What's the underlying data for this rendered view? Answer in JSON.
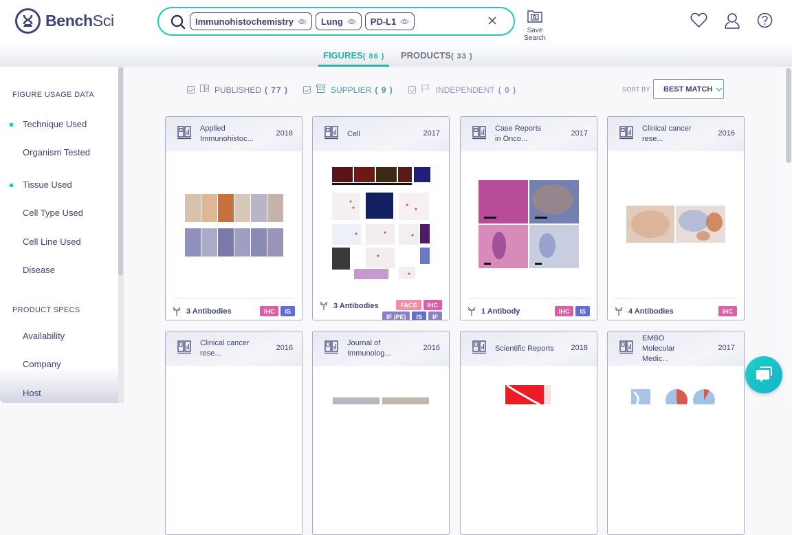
{
  "app": {
    "brand_bold": "Bench",
    "brand_light": "Sci"
  },
  "search": {
    "chips": [
      {
        "label": "Immunohistochemistry"
      },
      {
        "label": "Lung"
      },
      {
        "label": "PD-L1"
      }
    ],
    "save_label": "Save Search"
  },
  "header_icons": [
    "heart-icon",
    "user-icon",
    "help-icon"
  ],
  "tabs": [
    {
      "label": "FIGURES",
      "count": "( 86 )",
      "active": true
    },
    {
      "label": "PRODUCTS",
      "count": "( 33 )",
      "active": false
    }
  ],
  "sidebar": {
    "sections": [
      {
        "title": "FIGURE USAGE DATA",
        "items": [
          {
            "label": "Technique Used",
            "active": true
          },
          {
            "label": "Organism Tested",
            "active": false
          },
          {
            "label": "Tissue Used",
            "active": true
          },
          {
            "label": "Cell Type Used",
            "active": false
          },
          {
            "label": "Cell Line Used",
            "active": false
          },
          {
            "label": "Disease",
            "active": false
          }
        ]
      },
      {
        "title": "PRODUCT SPECS",
        "items": [
          {
            "label": "Availability"
          },
          {
            "label": "Company"
          },
          {
            "label": "Host"
          }
        ]
      }
    ]
  },
  "filters": [
    {
      "label": "PUBLISHED",
      "count": "( 77 )",
      "checked": true,
      "color": "#6f7aa8"
    },
    {
      "label": "SUPPLIER",
      "count": "( 9 )",
      "checked": true,
      "color": "#4e9aa6"
    },
    {
      "label": "INDEPENDENT",
      "count": "( 0 )",
      "checked": true,
      "color": "#9b8fdc"
    }
  ],
  "sort": {
    "label": "SORT BY",
    "value": "BEST MATCH"
  },
  "cards": [
    {
      "title": "Applied Immunohistoc...",
      "year": "2018",
      "antibodies": "3 Antibodies",
      "tags": [
        "IHC",
        "IS"
      ]
    },
    {
      "title": "Cell",
      "year": "2017",
      "antibodies": "3 Antibodies",
      "tags": [
        "FACS",
        "IHC",
        "IF (PE)",
        "IS",
        "IF"
      ]
    },
    {
      "title": "Case Reports in Onco...",
      "year": "2017",
      "antibodies": "1 Antibody",
      "tags": [
        "IHC",
        "IS"
      ]
    },
    {
      "title": "Clinical cancer rese...",
      "year": "2016",
      "antibodies": "4 Antibodies",
      "tags": [
        "IHC"
      ]
    },
    {
      "title": "Clinical cancer rese...",
      "year": "2016"
    },
    {
      "title": "Journal of Immunolog...",
      "year": "2016"
    },
    {
      "title": "Scientific Reports",
      "year": "2018"
    },
    {
      "title": "EMBO Molecular Medic...",
      "year": "2017"
    }
  ],
  "colors": {
    "accent": "#1ecab0",
    "brand": "#3d4576",
    "ihc": "#dc5ea9",
    "is": "#5f6cd6",
    "facs": "#ef8ea4",
    "if": "#8c80c6"
  }
}
